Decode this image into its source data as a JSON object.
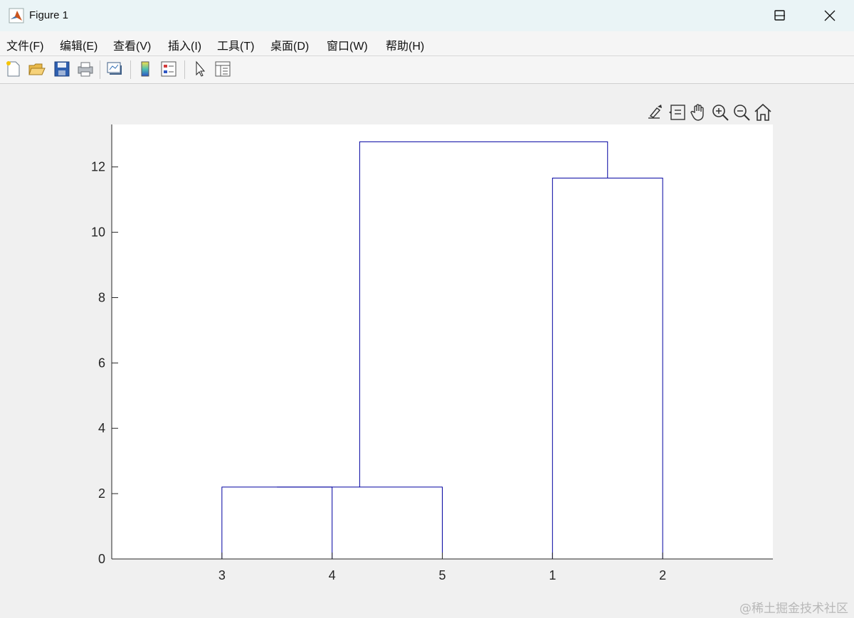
{
  "window": {
    "title": "Figure 1"
  },
  "menu": [
    {
      "label": "文件(F)"
    },
    {
      "label": "编辑(E)"
    },
    {
      "label": "查看(V)"
    },
    {
      "label": "插入(I)"
    },
    {
      "label": "工具(T)"
    },
    {
      "label": "桌面(D)"
    },
    {
      "label": "窗口(W)"
    },
    {
      "label": "帮助(H)"
    }
  ],
  "toolbar": {
    "icons": [
      "new-figure-icon",
      "open-file-icon",
      "save-icon",
      "print-icon",
      "link-plot-icon",
      "colorbar-icon",
      "legend-icon",
      "edit-plot-icon",
      "property-inspector-icon"
    ]
  },
  "axes_toolbar": {
    "icons": [
      "brush-icon",
      "datatip-icon",
      "pan-hand-icon",
      "zoom-in-icon",
      "zoom-out-icon",
      "home-icon"
    ]
  },
  "chart_data": {
    "type": "dendrogram",
    "title": "",
    "xlabel": "",
    "ylabel": "",
    "leaf_order": [
      "3",
      "4",
      "5",
      "1",
      "2"
    ],
    "ylim": [
      0,
      13.3
    ],
    "yticks": [
      0,
      2,
      4,
      6,
      8,
      10,
      12
    ],
    "links": [
      {
        "left": "3",
        "right": "4",
        "height": 2.2
      },
      {
        "left": "(3,4)",
        "right": "5",
        "height": 2.2
      },
      {
        "left": "1",
        "right": "2",
        "height": 11.66
      },
      {
        "left": "(3,4,5)",
        "right": "(1,2)",
        "height": 12.77
      }
    ],
    "line_color": "#0000a0",
    "grid": false
  },
  "watermark": "@稀土掘金技术社区"
}
